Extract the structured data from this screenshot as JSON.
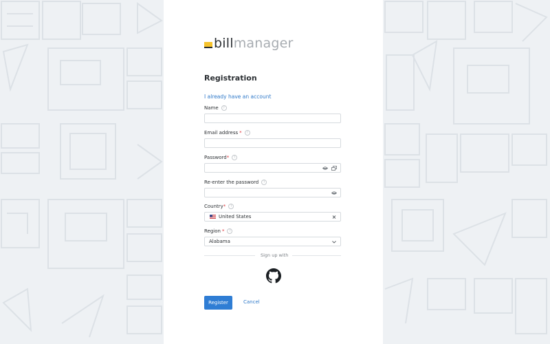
{
  "brand": {
    "name_bold": "bill",
    "name_light": "manager"
  },
  "form": {
    "title": "Registration",
    "have_account_link": "I already have an account",
    "name": {
      "label": "Name",
      "value": "",
      "placeholder": ""
    },
    "email": {
      "label": "Email address",
      "required_mark": "*",
      "value": "",
      "placeholder": ""
    },
    "password": {
      "label": "Password",
      "required_mark": "*",
      "value": ""
    },
    "reenter_password": {
      "label": "Re-enter the password",
      "value": ""
    },
    "country": {
      "label": "Country",
      "required_mark": "*",
      "selected": "United States"
    },
    "region": {
      "label": "Region",
      "required_mark": "*",
      "selected": "Alabama"
    },
    "help_glyph": "?",
    "signup_with": "Sign up with",
    "register_button": "Register",
    "cancel_button": "Cancel"
  },
  "colors": {
    "accent": "#2f7dd4",
    "link": "#2f79c9",
    "required": "#e0343a",
    "logo_yellow": "#f6c32c"
  },
  "icons": {
    "password_toggle": "eye-icon",
    "password_generate": "key-generate-icon",
    "country_clear": "close-icon",
    "region_dropdown": "chevron-down-icon",
    "social_provider": "github-icon",
    "country_flag": "us-flag-icon"
  }
}
